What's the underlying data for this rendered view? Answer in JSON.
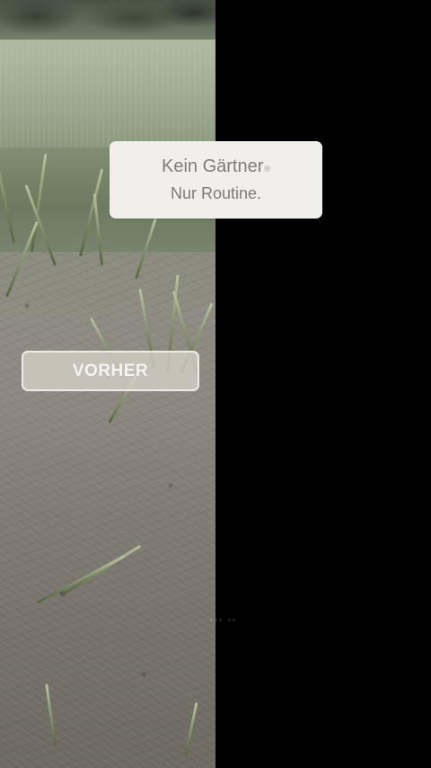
{
  "headline": {
    "line1": "Kein Gärtner",
    "registered_mark": "®",
    "line2": "Nur Routine."
  },
  "label": {
    "before": "VORHER"
  },
  "colors": {
    "right_panel": "#000000",
    "card_background": "#f1efec",
    "card_text": "#7d7c78"
  }
}
